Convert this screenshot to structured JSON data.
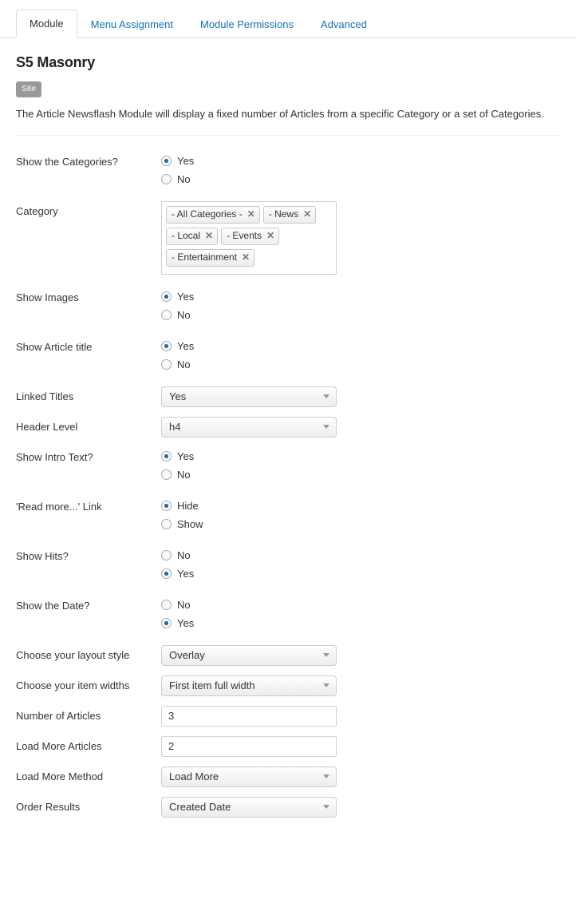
{
  "tabs": [
    {
      "label": "Module",
      "active": true
    },
    {
      "label": "Menu Assignment",
      "active": false
    },
    {
      "label": "Module Permissions",
      "active": false
    },
    {
      "label": "Advanced",
      "active": false
    }
  ],
  "header": {
    "title": "S5 Masonry",
    "badge": "Site",
    "description": "The Article Newsflash Module will display a fixed number of Articles from a specific Category or a set of Categories."
  },
  "form": {
    "rows": [
      {
        "id": "show-the-categories",
        "label": "Show the Categories?",
        "type": "radio",
        "options": [
          {
            "label": "Yes",
            "checked": true
          },
          {
            "label": "No",
            "checked": false
          }
        ]
      },
      {
        "id": "category",
        "label": "Category",
        "type": "chips",
        "chips": [
          {
            "label": "- All Categories -",
            "remove": "✕"
          },
          {
            "label": "- News",
            "remove": "✕"
          },
          {
            "label": "- Local",
            "remove": "✕"
          },
          {
            "label": "- Events",
            "remove": "✕"
          },
          {
            "label": "- Entertainment",
            "remove": "✕"
          }
        ]
      },
      {
        "id": "show-images",
        "label": "Show Images",
        "type": "radio",
        "options": [
          {
            "label": "Yes",
            "checked": true
          },
          {
            "label": "No",
            "checked": false
          }
        ]
      },
      {
        "id": "show-article-title",
        "label": "Show Article title",
        "type": "radio",
        "options": [
          {
            "label": "Yes",
            "checked": true
          },
          {
            "label": "No",
            "checked": false
          }
        ]
      },
      {
        "id": "linked-titles",
        "label": "Linked Titles",
        "type": "select",
        "value": "Yes"
      },
      {
        "id": "header-level",
        "label": "Header Level",
        "type": "select",
        "value": "h4"
      },
      {
        "id": "show-intro-text",
        "label": "Show Intro Text?",
        "type": "radio",
        "options": [
          {
            "label": "Yes",
            "checked": true
          },
          {
            "label": "No",
            "checked": false
          }
        ]
      },
      {
        "id": "read-more-link",
        "label": "'Read more...' Link",
        "type": "radio",
        "options": [
          {
            "label": "Hide",
            "checked": true
          },
          {
            "label": "Show",
            "checked": false
          }
        ]
      },
      {
        "id": "show-hits",
        "label": "Show Hits?",
        "type": "radio",
        "options": [
          {
            "label": "No",
            "checked": false
          },
          {
            "label": "Yes",
            "checked": true
          }
        ]
      },
      {
        "id": "show-the-date",
        "label": "Show the Date?",
        "type": "radio",
        "options": [
          {
            "label": "No",
            "checked": false
          },
          {
            "label": "Yes",
            "checked": true
          }
        ]
      },
      {
        "id": "choose-your-layout-style",
        "label": "Choose your layout style",
        "type": "select",
        "value": "Overlay"
      },
      {
        "id": "choose-your-item-widths",
        "label": "Choose your item widths",
        "type": "select",
        "value": "First item full width"
      },
      {
        "id": "number-of-articles",
        "label": "Number of Articles",
        "type": "text",
        "value": "3"
      },
      {
        "id": "load-more-articles",
        "label": "Load More Articles",
        "type": "text",
        "value": "2"
      },
      {
        "id": "load-more-method",
        "label": "Load More Method",
        "type": "select",
        "value": "Load More"
      },
      {
        "id": "order-results",
        "label": "Order Results",
        "type": "select",
        "value": "Created Date"
      }
    ]
  },
  "colors": {
    "tab_link": "#1173b5",
    "radio_dot": "#1569a8",
    "badge_bg": "#999999",
    "border": "#cccccc"
  }
}
